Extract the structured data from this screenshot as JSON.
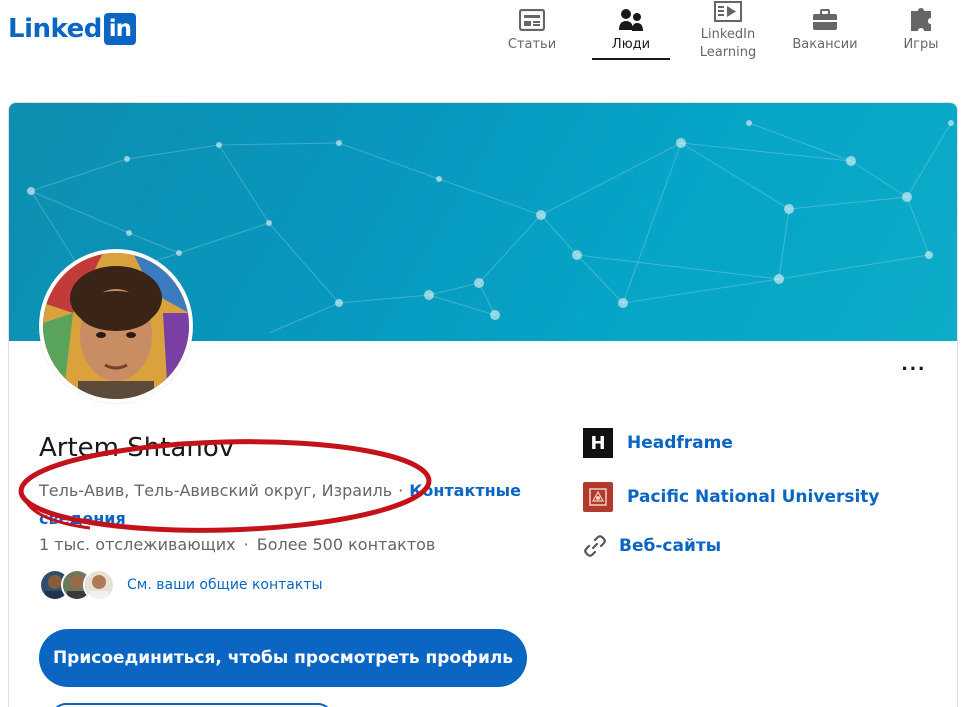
{
  "brand": {
    "logo_text": "Linked",
    "logo_box_text": "in",
    "color": "#0a66c2"
  },
  "nav": {
    "items": [
      {
        "label": "Статьи",
        "icon": "articles-icon",
        "active": false
      },
      {
        "label": "Люди",
        "icon": "people-icon",
        "active": true
      },
      {
        "label": "LinkedIn\nLearning",
        "icon": "learning-icon",
        "active": false
      },
      {
        "label": "Вакансии",
        "icon": "briefcase-icon",
        "active": false
      },
      {
        "label": "Игры",
        "icon": "puzzle-icon",
        "active": false
      }
    ]
  },
  "profile": {
    "name": "Artem Shtanov",
    "location": "Тель-Авив, Тель-Авивский округ, Израиль",
    "separator": "·",
    "contact_info_label": "Контактные сведения",
    "followers": "1 тыс. отслеживающих",
    "connections": "Более 500 контактов",
    "mutual_contacts_label": "См. ваши общие контакты",
    "join_button_label": "Присоединиться, чтобы просмотреть профиль",
    "more_label": "···"
  },
  "right_panel": {
    "company": {
      "label": "Headframe",
      "icon_letter": "H"
    },
    "education": {
      "label": "Pacific National University"
    },
    "websites": {
      "label": "Веб-сайты"
    }
  },
  "colors": {
    "accent": "#0a66c2",
    "cover_start": "#0d8fb0",
    "cover_end": "#0dacc8",
    "annotation_red": "#c4121b"
  }
}
